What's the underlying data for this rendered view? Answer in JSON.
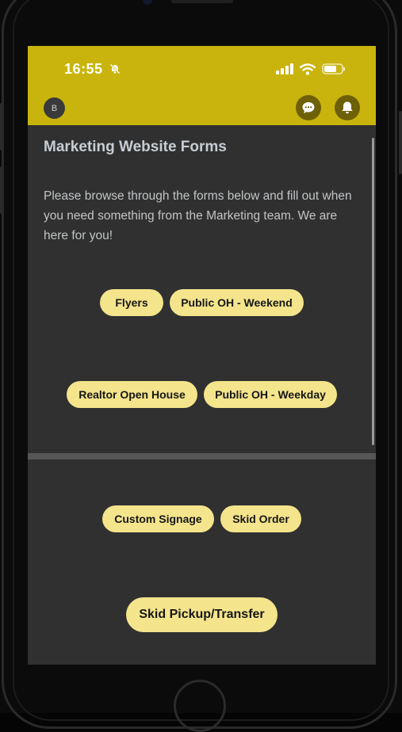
{
  "status_bar": {
    "time": "16:55"
  },
  "header": {
    "avatar_initial": "B"
  },
  "page": {
    "title": "Marketing Website Forms",
    "intro": "Please browse through the forms below and fill out when you need something from the Marketing team. We are here for you!"
  },
  "forms": [
    {
      "label": "Flyers"
    },
    {
      "label": "Public OH - Weekend"
    },
    {
      "label": "Realtor Open House"
    },
    {
      "label": "Public OH - Weekday"
    },
    {
      "label": "Custom Signage"
    },
    {
      "label": "Skid Order"
    },
    {
      "label": "Skid Pickup/Transfer"
    }
  ],
  "colors": {
    "header_background": "#c9b40d",
    "page_background": "#303030",
    "button_background": "#f4e48c",
    "title_text": "#c7cdd3"
  },
  "icons": {
    "status": [
      "bell-slash-icon",
      "signal-icon",
      "wifi-icon",
      "battery-icon"
    ],
    "header": [
      "chat-icon",
      "notification-bell-icon"
    ]
  }
}
